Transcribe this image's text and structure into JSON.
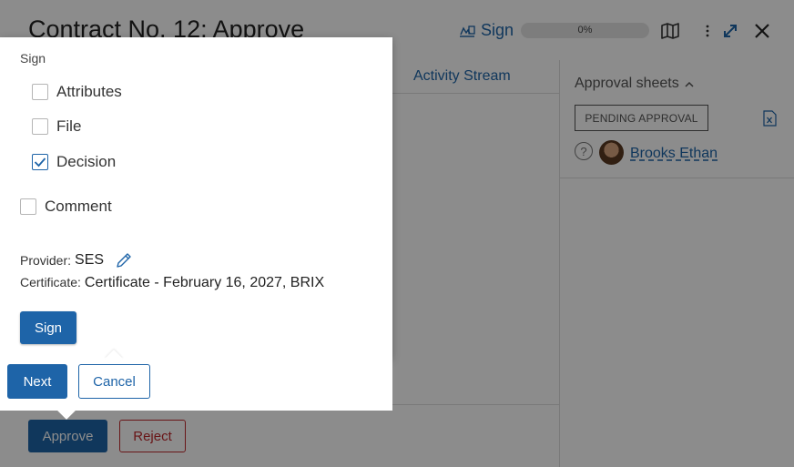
{
  "header": {
    "title": "Contract No. 12: Approve",
    "sign_label": "Sign",
    "progress_text": "0%",
    "progress_value": 0
  },
  "tabs": {
    "activity_stream": "Activity Stream"
  },
  "approval": {
    "title": "Approval sheets",
    "status_badge": "PENDING APPROVAL",
    "user_name": "Brooks Ethan",
    "help_glyph": "?"
  },
  "actions": {
    "approve": "Approve",
    "reject": "Reject"
  },
  "sign_popup": {
    "caption": "Sign",
    "options": [
      {
        "label": "Attributes",
        "checked": false
      },
      {
        "label": "File",
        "checked": false
      },
      {
        "label": "Decision",
        "checked": true
      }
    ],
    "comment": {
      "label": "Comment",
      "checked": false
    },
    "provider_label": "Provider:",
    "provider_value": "SES",
    "certificate_label": "Certificate:",
    "certificate_value": "Certificate - February 16, 2027, BRIX",
    "sign_button": "Sign"
  },
  "tour": {
    "next": "Next",
    "cancel": "Cancel"
  },
  "colors": {
    "accent": "#1e64a8",
    "danger": "#c0282d"
  },
  "icons": [
    "sign-icon",
    "map-icon",
    "kebab-icon",
    "expand-icon",
    "close-icon",
    "chevron-up-icon",
    "excel-icon",
    "help-icon",
    "pencil-icon",
    "check-icon"
  ]
}
